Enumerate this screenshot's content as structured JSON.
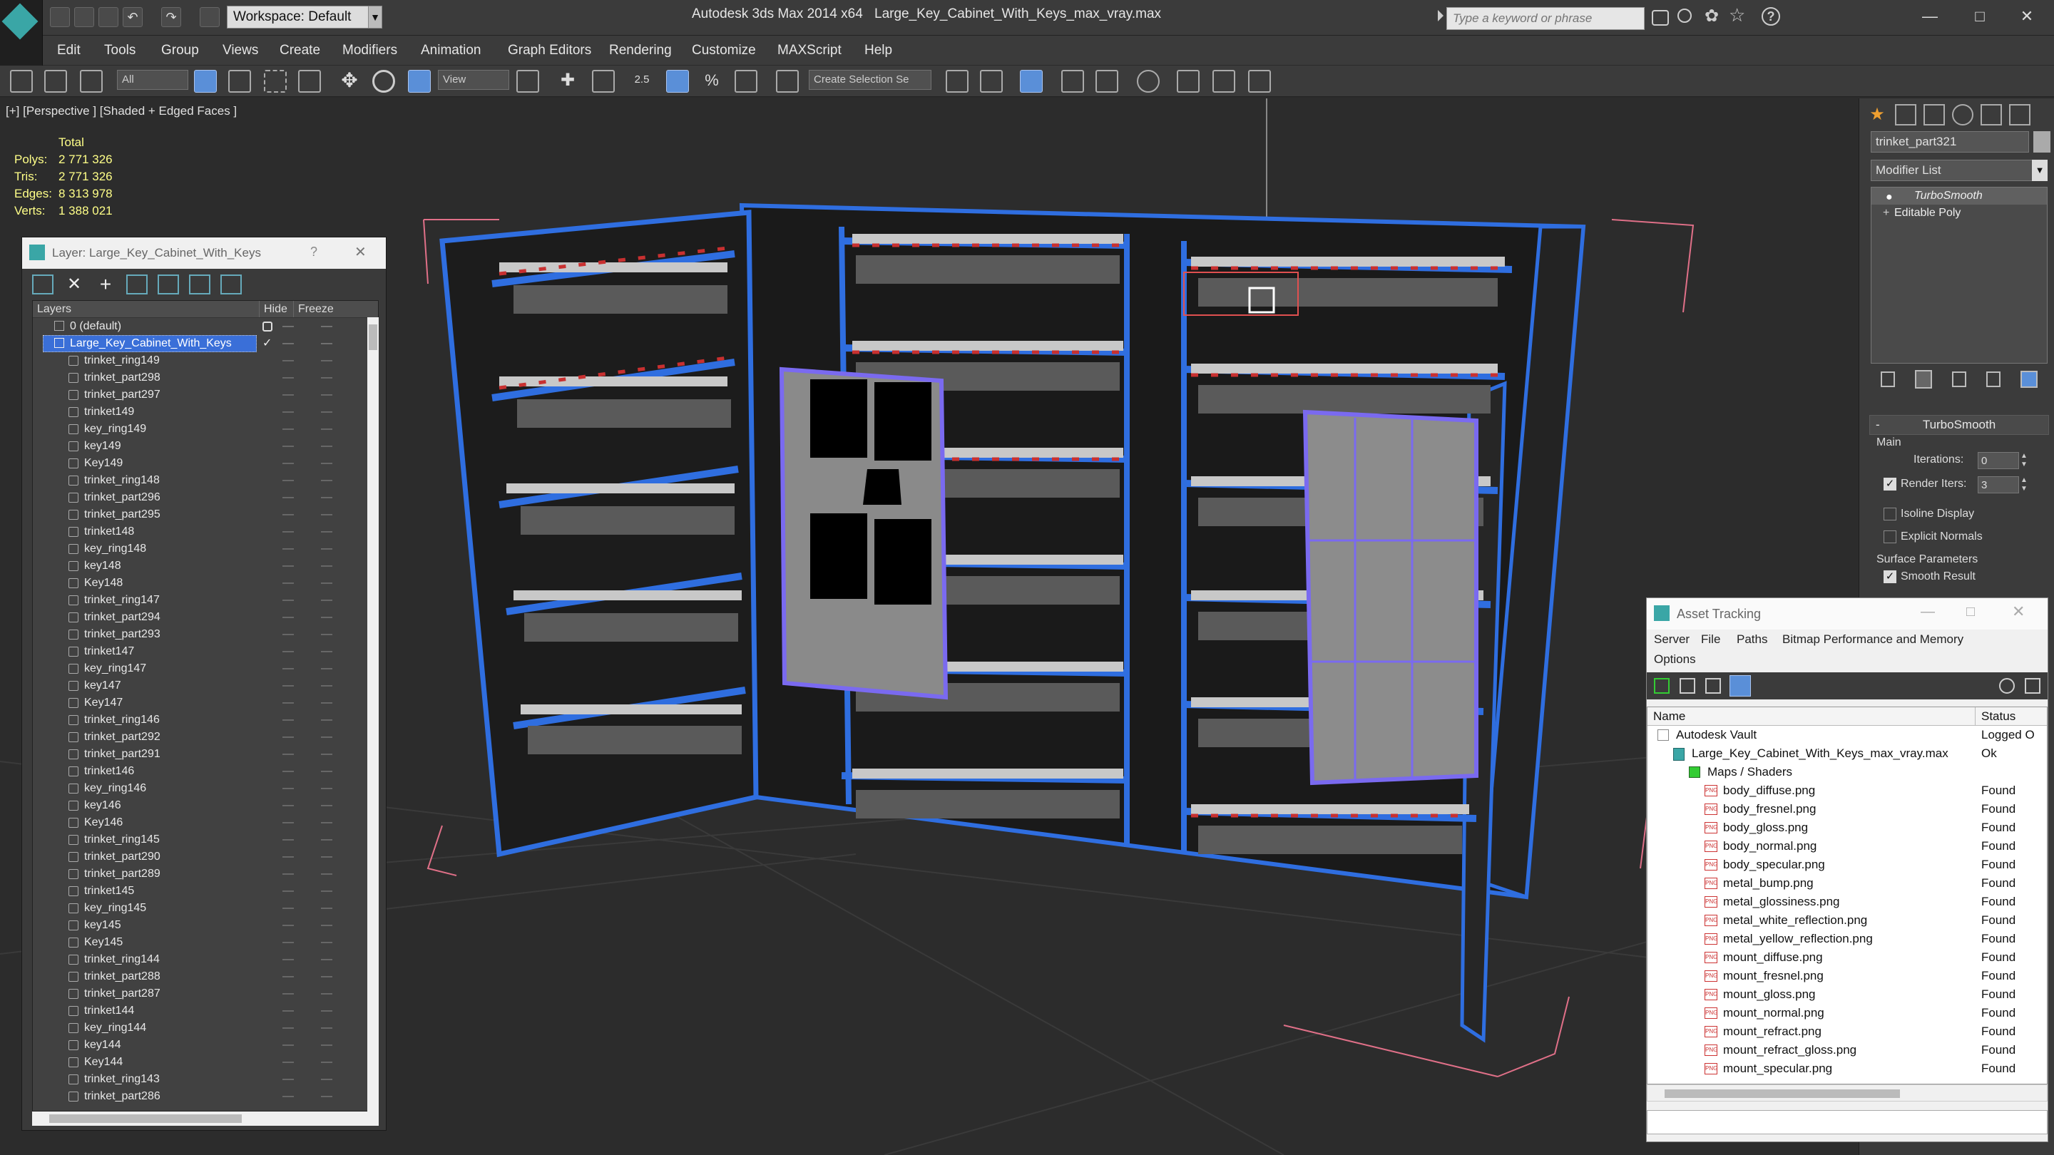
{
  "titlebar": {
    "app_title": "Autodesk 3ds Max  2014 x64",
    "file_title": "Large_Key_Cabinet_With_Keys_max_vray.max",
    "workspace": "Workspace: Default",
    "search_placeholder": "Type a keyword or phrase"
  },
  "menu": [
    "Edit",
    "Tools",
    "Group",
    "Views",
    "Create",
    "Modifiers",
    "Animation",
    "Graph Editors",
    "Rendering",
    "Customize",
    "MAXScript",
    "Help"
  ],
  "toolbar": {
    "filter": "All",
    "ref_coord": "View",
    "selection_set": "Create Selection Se",
    "snap_value": "2.5"
  },
  "viewport": {
    "label": "[+] [Perspective ] [Shaded + Edged Faces ]",
    "stats": {
      "total_label": "Total",
      "rows": [
        {
          "label": "Polys:",
          "value": "2 771 326"
        },
        {
          "label": "Tris:",
          "value": "2 771 326"
        },
        {
          "label": "Edges:",
          "value": "8 313 978"
        },
        {
          "label": "Verts:",
          "value": "1 388 021"
        }
      ]
    }
  },
  "layer_window": {
    "title": "Layer: Large_Key_Cabinet_With_Keys",
    "help": "?",
    "columns": [
      "Layers",
      "Hide",
      "Freeze"
    ],
    "layers": [
      {
        "name": "0 (default)",
        "level": 1
      },
      {
        "name": "Large_Key_Cabinet_With_Keys",
        "level": 1,
        "selected": true
      }
    ],
    "objects": [
      "trinket_ring149",
      "trinket_part298",
      "trinket_part297",
      "trinket149",
      "key_ring149",
      "key149",
      "Key149",
      "trinket_ring148",
      "trinket_part296",
      "trinket_part295",
      "trinket148",
      "key_ring148",
      "key148",
      "Key148",
      "trinket_ring147",
      "trinket_part294",
      "trinket_part293",
      "trinket147",
      "key_ring147",
      "key147",
      "Key147",
      "trinket_ring146",
      "trinket_part292",
      "trinket_part291",
      "trinket146",
      "key_ring146",
      "key146",
      "Key146",
      "trinket_ring145",
      "trinket_part290",
      "trinket_part289",
      "trinket145",
      "key_ring145",
      "key145",
      "Key145",
      "trinket_ring144",
      "trinket_part288",
      "trinket_part287",
      "trinket144",
      "key_ring144",
      "key144",
      "Key144",
      "trinket_ring143",
      "trinket_part286"
    ]
  },
  "command_panel": {
    "object_name": "trinket_part321",
    "modifier_list": "Modifier List",
    "stack": [
      "TurboSmooth",
      "Editable Poly"
    ],
    "rollout_title": "TurboSmooth",
    "main_label": "Main",
    "iterations_label": "Iterations:",
    "iterations_value": "0",
    "render_iters_label": "Render Iters:",
    "render_iters_value": "3",
    "render_iters_checked": true,
    "isoline_label": "Isoline Display",
    "explicit_normals_label": "Explicit Normals",
    "surface_params_label": "Surface Parameters",
    "smooth_result_label": "Smooth Result",
    "smooth_result_checked": true
  },
  "asset_tracking": {
    "title": "Asset Tracking",
    "menu": [
      "Server",
      "File",
      "Paths",
      "Bitmap Performance and Memory",
      "Options"
    ],
    "columns": [
      "Name",
      "Status"
    ],
    "rows": [
      {
        "name": "Autodesk Vault",
        "status": "Logged O",
        "level": 0,
        "icon": "vault-icon"
      },
      {
        "name": "Large_Key_Cabinet_With_Keys_max_vray.max",
        "status": "Ok",
        "level": 1,
        "icon": "max-file-icon"
      },
      {
        "name": "Maps / Shaders",
        "status": "",
        "level": 2,
        "icon": "maps-icon"
      },
      {
        "name": "body_diffuse.png",
        "status": "Found",
        "level": 3,
        "icon": "png-icon"
      },
      {
        "name": "body_fresnel.png",
        "status": "Found",
        "level": 3,
        "icon": "png-icon"
      },
      {
        "name": "body_gloss.png",
        "status": "Found",
        "level": 3,
        "icon": "png-icon"
      },
      {
        "name": "body_normal.png",
        "status": "Found",
        "level": 3,
        "icon": "png-icon"
      },
      {
        "name": "body_specular.png",
        "status": "Found",
        "level": 3,
        "icon": "png-icon"
      },
      {
        "name": "metal_bump.png",
        "status": "Found",
        "level": 3,
        "icon": "png-icon"
      },
      {
        "name": "metal_glossiness.png",
        "status": "Found",
        "level": 3,
        "icon": "png-icon"
      },
      {
        "name": "metal_white_reflection.png",
        "status": "Found",
        "level": 3,
        "icon": "png-icon"
      },
      {
        "name": "metal_yellow_reflection.png",
        "status": "Found",
        "level": 3,
        "icon": "png-icon"
      },
      {
        "name": "mount_diffuse.png",
        "status": "Found",
        "level": 3,
        "icon": "png-icon"
      },
      {
        "name": "mount_fresnel.png",
        "status": "Found",
        "level": 3,
        "icon": "png-icon"
      },
      {
        "name": "mount_gloss.png",
        "status": "Found",
        "level": 3,
        "icon": "png-icon"
      },
      {
        "name": "mount_normal.png",
        "status": "Found",
        "level": 3,
        "icon": "png-icon"
      },
      {
        "name": "mount_refract.png",
        "status": "Found",
        "level": 3,
        "icon": "png-icon"
      },
      {
        "name": "mount_refract_gloss.png",
        "status": "Found",
        "level": 3,
        "icon": "png-icon"
      },
      {
        "name": "mount_specular.png",
        "status": "Found",
        "level": 3,
        "icon": "png-icon"
      }
    ]
  },
  "colors": {
    "accent": "#3a6fd8",
    "wire_blue": "#2f6ee0",
    "selection_red": "#e05050",
    "stats_yellow": "#ffff88"
  }
}
